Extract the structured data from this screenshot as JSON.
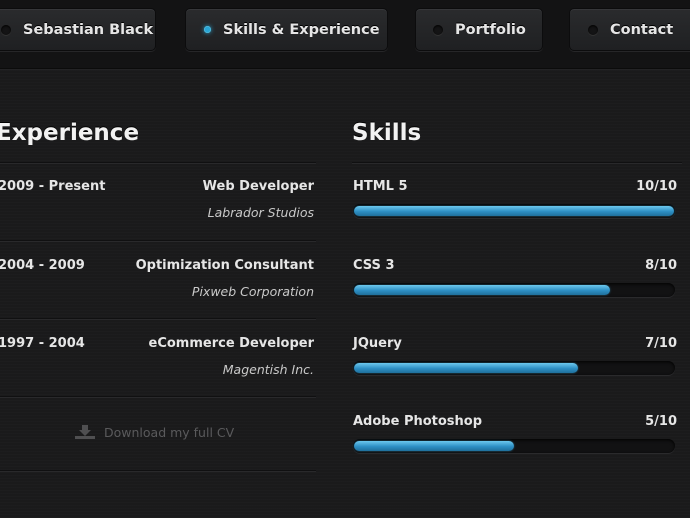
{
  "nav": {
    "tabs": [
      {
        "label": "Sebastian Black",
        "active": false
      },
      {
        "label": "Skills & Experience",
        "active": true
      },
      {
        "label": "Portfolio",
        "active": false
      },
      {
        "label": "Contact",
        "active": false
      }
    ]
  },
  "experience": {
    "title": "Experience",
    "items": [
      {
        "years": "2009 - Present",
        "role": "Web Developer",
        "company": "Labrador Studios"
      },
      {
        "years": "2004 - 2009",
        "role": "Optimization Consultant",
        "company": "Pixweb Corporation"
      },
      {
        "years": "1997 - 2004",
        "role": "eCommerce Developer",
        "company": "Magentish Inc."
      }
    ],
    "download_label": "Download my full CV"
  },
  "skills": {
    "title": "Skills",
    "items": [
      {
        "name": "HTML 5",
        "score": "10/10",
        "level": 1.0
      },
      {
        "name": "CSS 3",
        "score": "8/10",
        "level": 0.8
      },
      {
        "name": "JQuery",
        "score": "7/10",
        "level": 0.7
      },
      {
        "name": "Adobe Photoshop",
        "score": "5/10",
        "level": 0.5
      }
    ]
  },
  "colors": {
    "accent": "#2aa6d6",
    "background": "#1a1a1b"
  }
}
